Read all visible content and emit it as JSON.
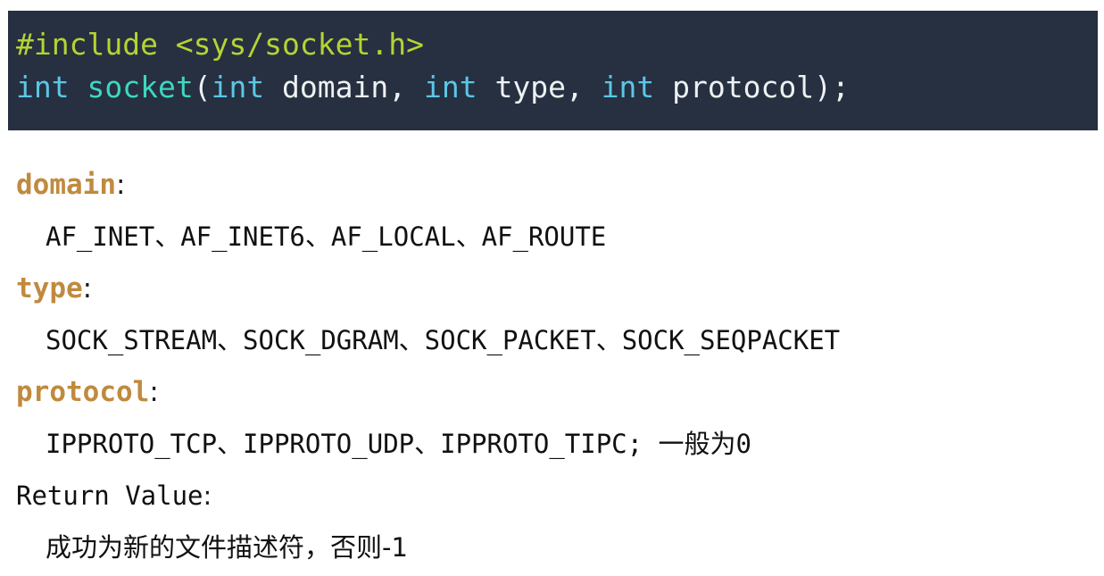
{
  "code": {
    "include_line": "#include <sys/socket.h>",
    "signature": {
      "ret_type": "int",
      "space1": " ",
      "func_name": "socket",
      "open_paren": "(",
      "p1_type": "int",
      "p1_name": " domain, ",
      "p2_type": "int",
      "p2_name": " type, ",
      "p3_type": "int",
      "p3_name": " protocol);"
    }
  },
  "params": [
    {
      "name": "domain",
      "colon": ":",
      "values": "AF_INET、AF_INET6、AF_LOCAL、AF_ROUTE"
    },
    {
      "name": "type",
      "colon": ":",
      "values": "SOCK_STREAM、SOCK_DGRAM、SOCK_PACKET、SOCK_SEQPACKET"
    },
    {
      "name": "protocol",
      "colon": ":",
      "values": "IPPROTO_TCP、IPPROTO_UDP、IPPROTO_TIPC; 一般为0"
    }
  ],
  "return_value": {
    "label": "Return Value",
    "colon": ":",
    "description": "成功为新的文件描述符，否则-1"
  },
  "colors": {
    "code_background": "#263040",
    "include_green": "#b5d334",
    "keyword_cyan": "#5cc6e6",
    "function_teal": "#3fd6c2",
    "param_name_orange": "#c08a3e"
  }
}
